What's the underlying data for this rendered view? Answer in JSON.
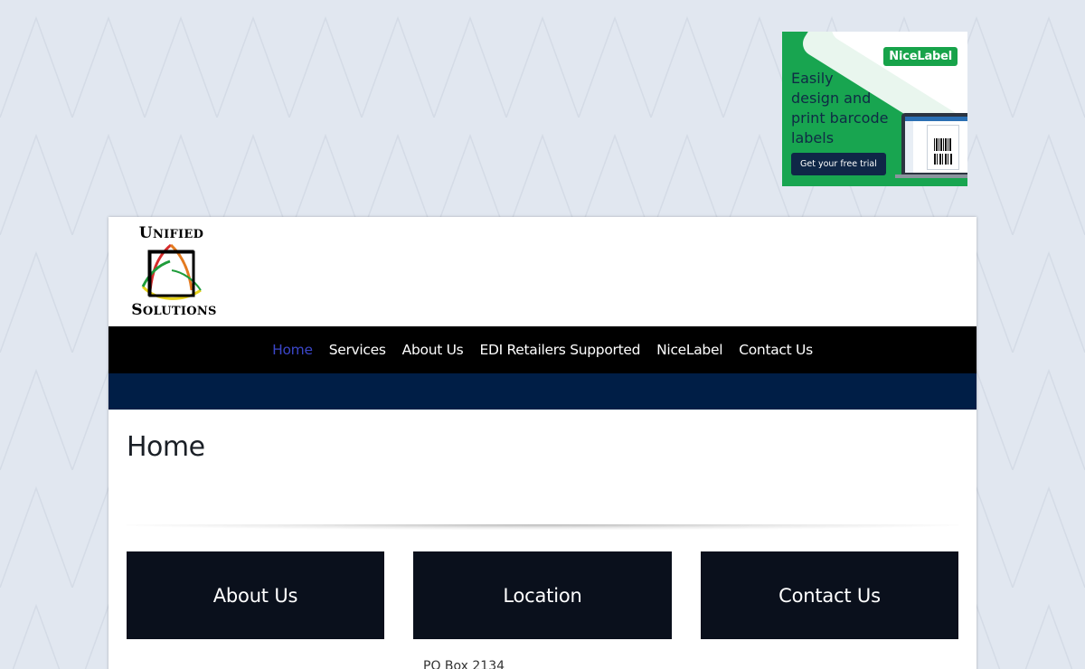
{
  "ad": {
    "brand": "NiceLabel",
    "headline": "Easily\ndesign and\nprint barcode\nlabels",
    "cta": "Get your free trial",
    "colors": {
      "background": "#18a550",
      "button": "#0f2747"
    }
  },
  "logo": {
    "top_first": "U",
    "top_rest": "NIFIED",
    "bottom_first": "S",
    "bottom_rest": "OLUTIONS"
  },
  "nav": {
    "items": [
      {
        "label": "Home",
        "active": true
      },
      {
        "label": "Services"
      },
      {
        "label": "About Us"
      },
      {
        "label": "EDI Retailers Supported"
      },
      {
        "label": "NiceLabel"
      },
      {
        "label": "Contact Us"
      }
    ],
    "active_color": "#3b46c8"
  },
  "page": {
    "title": "Home"
  },
  "boxes": [
    {
      "label": "About Us"
    },
    {
      "label": "Location"
    },
    {
      "label": "Contact Us"
    }
  ],
  "location": {
    "line1": "PO Box 2134"
  },
  "colors": {
    "page_background": "#e1e7f0",
    "nav_background": "#000000",
    "subbar": "#001e46",
    "box_background": "#0a101c"
  }
}
